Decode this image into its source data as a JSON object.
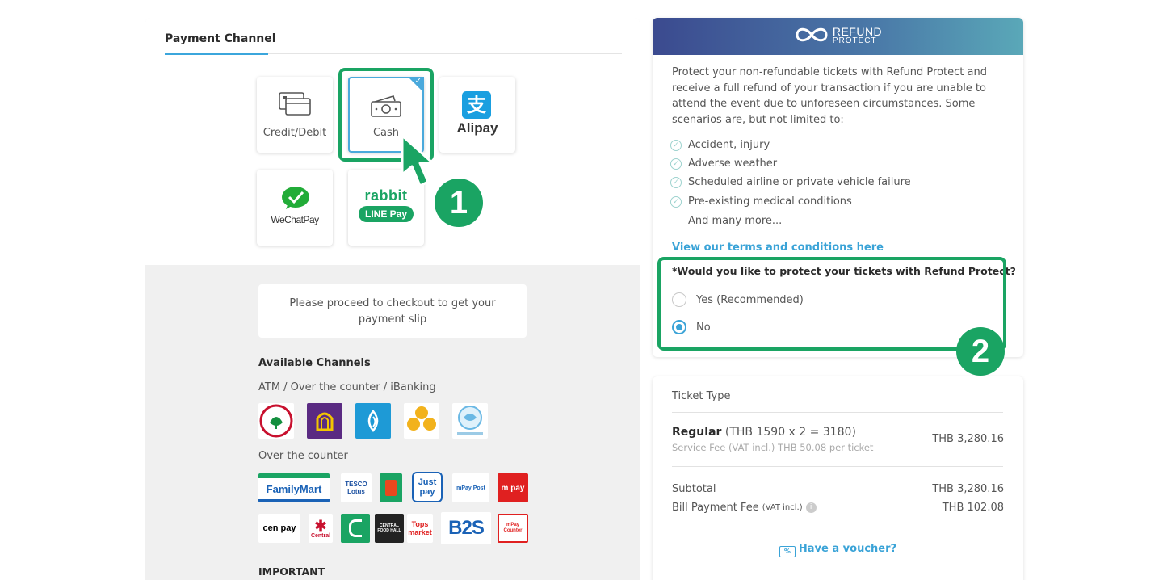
{
  "payment_channel": {
    "title": "Payment Channel",
    "methods": [
      {
        "label": "Credit/Debit",
        "icon": "credit-card-icon"
      },
      {
        "label": "Cash",
        "icon": "cash-icon",
        "selected": true
      },
      {
        "label": "Alipay",
        "icon": "alipay-logo"
      },
      {
        "label": "WeChat Pay",
        "icon": "wechat-pay-logo"
      },
      {
        "label": "LINE Pay",
        "icon": "rabbit-line-pay-logo",
        "logo_text_top": "rabbit"
      }
    ],
    "alipay_text": "Alipay",
    "alipay_glyph": "支",
    "wechat_text": "WeChatPay",
    "callouts": [
      "1",
      "2"
    ]
  },
  "cash_info": {
    "slip_message": "Please proceed to checkout to get your payment slip",
    "available_channels_heading": "Available Channels",
    "atm_label": "ATM / Over the counter / iBanking",
    "counter_label": "Over the counter",
    "important_heading": "IMPORTANT",
    "stores_row1": [
      "FamilyMart",
      "TESCO Lotus",
      "",
      "Just pay",
      "mPay Post",
      "m pay"
    ],
    "stores_row2": [
      "cen pay",
      "Central",
      "",
      "CENTRAL FOOD HALL",
      "Tops market",
      "B2S",
      "mPay Counter"
    ]
  },
  "refund_protect": {
    "brand_line1": "REFUND",
    "brand_line2": "PROTECT",
    "intro": "Protect your non-refundable tickets with Refund Protect and receive a full refund of your transaction if you are unable to attend the event due to unforeseen circumstances. Some scenarios are, but not limited to:",
    "scenarios": [
      "Accident, injury",
      "Adverse weather",
      "Scheduled airline or private vehicle failure",
      "Pre-existing medical conditions"
    ],
    "more": "And many more...",
    "terms_link": "View our terms and conditions here",
    "question": "*Would you like to protect your tickets with Refund Protect?",
    "option_yes": "Yes (Recommended)",
    "option_no": "No",
    "selected": "No"
  },
  "summary": {
    "ticket_type_label": "Ticket Type",
    "ticket_name": "Regular",
    "ticket_calc": " (THB 1590 x 2 = 3180)",
    "ticket_total": "THB 3,280.16",
    "service_fee": "Service Fee (VAT incl.) THB 50.08 per ticket",
    "subtotal_label": "Subtotal",
    "subtotal_value": "THB 3,280.16",
    "bill_fee_label": "Bill Payment Fee",
    "bill_fee_note": "(VAT incl.)",
    "bill_fee_value": "THB 102.08",
    "voucher_label": "Have a voucher?"
  },
  "colors": {
    "accent_green": "#1aa463",
    "link_blue": "#3aa3d7"
  }
}
